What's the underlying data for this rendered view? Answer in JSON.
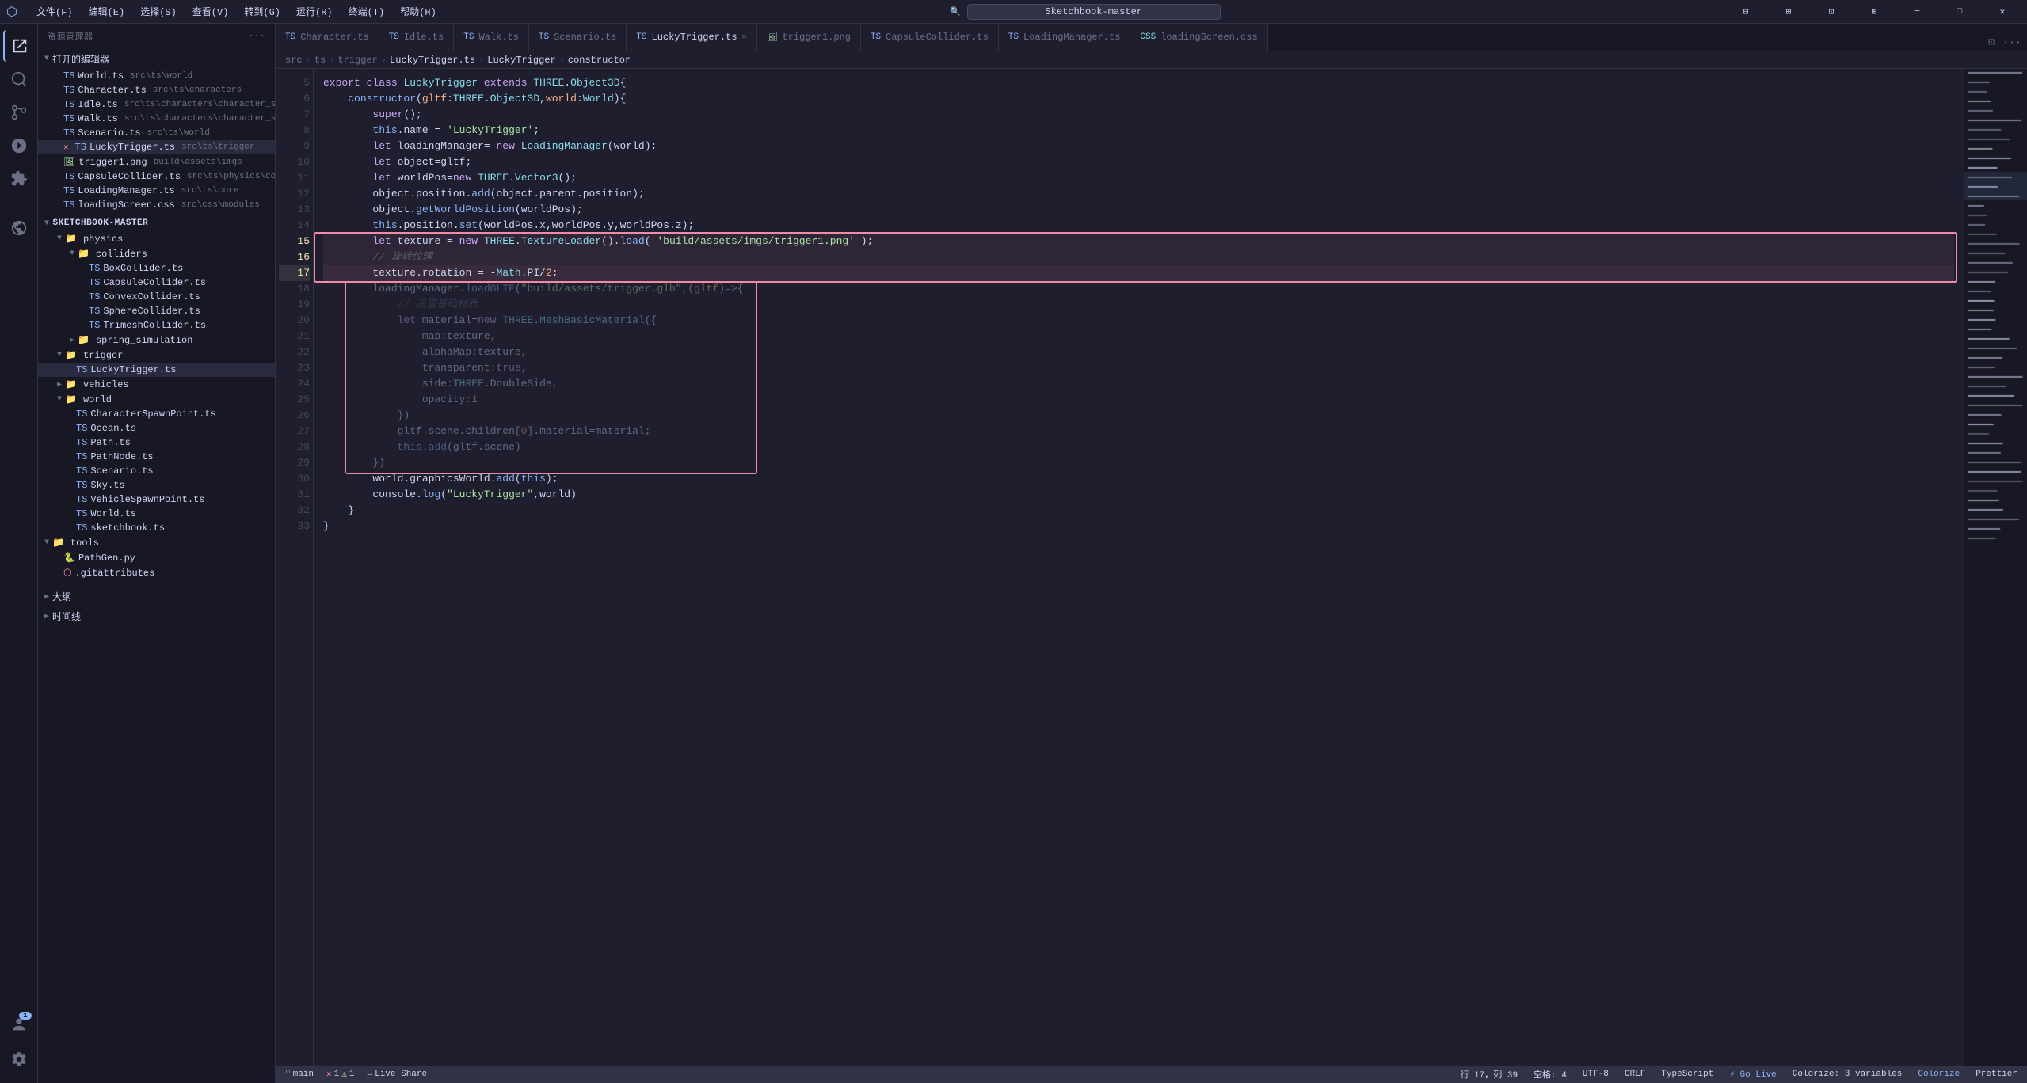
{
  "titlebar": {
    "menus": [
      "文件(F)",
      "编辑(E)",
      "选择(S)",
      "查看(V)",
      "转到(G)",
      "运行(R)",
      "终端(T)",
      "帮助(H)"
    ],
    "search_placeholder": "Sketchbook-master",
    "icon": "▶"
  },
  "activity_bar": {
    "icons": [
      {
        "name": "explorer-icon",
        "glyph": "⎘",
        "active": true
      },
      {
        "name": "search-icon",
        "glyph": "🔍"
      },
      {
        "name": "git-icon",
        "glyph": "⑂"
      },
      {
        "name": "debug-icon",
        "glyph": "▷"
      },
      {
        "name": "extensions-icon",
        "glyph": "⊞"
      },
      {
        "name": "live-share-icon",
        "glyph": "⧉"
      }
    ],
    "bottom_icons": [
      {
        "name": "account-icon",
        "glyph": "👤"
      },
      {
        "name": "settings-icon",
        "glyph": "⚙"
      }
    ]
  },
  "sidebar": {
    "title": "资源管理器",
    "section_open_editors": "打开的编辑器",
    "open_files": [
      {
        "name": "World.ts",
        "path": "src\\ts\\world",
        "icon": "ts",
        "indent": 1
      },
      {
        "name": "Character.ts",
        "path": "src\\ts\\characters",
        "icon": "ts",
        "indent": 1
      },
      {
        "name": "Idle.ts",
        "path": "src\\ts\\characters\\character_states",
        "icon": "ts",
        "indent": 1
      },
      {
        "name": "Walk.ts",
        "path": "src\\ts\\characters\\character_states",
        "icon": "ts",
        "indent": 1
      },
      {
        "name": "Scenario.ts",
        "path": "src\\ts\\world",
        "icon": "ts",
        "indent": 1
      },
      {
        "name": "LuckyTrigger.ts",
        "path": "src\\ts\\trigger",
        "icon": "ts",
        "indent": 1,
        "active": true,
        "has_close": true
      },
      {
        "name": "trigger1.png",
        "path": "build\\assets\\imgs",
        "icon": "png",
        "indent": 1
      },
      {
        "name": "CapsuleCollider.ts",
        "path": "src\\ts\\physics\\colliders",
        "icon": "ts",
        "indent": 1
      },
      {
        "name": "LoadingManager.ts",
        "path": "src\\ts\\core",
        "icon": "ts",
        "indent": 1
      },
      {
        "name": "loadingScreen.css",
        "path": "src\\css\\modules",
        "icon": "ts",
        "indent": 1
      }
    ],
    "project_name": "SKETCHBOOK-MASTER",
    "tree": [
      {
        "type": "folder",
        "name": "physics",
        "indent": 1,
        "open": true
      },
      {
        "type": "folder",
        "name": "colliders",
        "indent": 2,
        "open": true
      },
      {
        "type": "file",
        "name": "BoxCollider.ts",
        "icon": "ts",
        "indent": 3
      },
      {
        "type": "file",
        "name": "CapsuleCollider.ts",
        "icon": "ts",
        "indent": 3
      },
      {
        "type": "file",
        "name": "ConvexCollider.ts",
        "icon": "ts",
        "indent": 3
      },
      {
        "type": "file",
        "name": "SphereCollider.ts",
        "icon": "ts",
        "indent": 3
      },
      {
        "type": "file",
        "name": "TrimeshCollider.ts",
        "icon": "ts",
        "indent": 3
      },
      {
        "type": "folder",
        "name": "spring_simulation",
        "indent": 2
      },
      {
        "type": "folder",
        "name": "trigger",
        "indent": 1,
        "open": true
      },
      {
        "type": "file",
        "name": "LuckyTrigger.ts",
        "icon": "ts",
        "indent": 2,
        "active": true
      },
      {
        "type": "folder",
        "name": "vehicles",
        "indent": 1
      },
      {
        "type": "folder",
        "name": "world",
        "indent": 1,
        "open": true
      },
      {
        "type": "file",
        "name": "CharacterSpawnPoint.ts",
        "icon": "ts",
        "indent": 2
      },
      {
        "type": "file",
        "name": "Ocean.ts",
        "icon": "ts",
        "indent": 2
      },
      {
        "type": "file",
        "name": "Path.ts",
        "icon": "ts",
        "indent": 2
      },
      {
        "type": "file",
        "name": "PathNode.ts",
        "icon": "ts",
        "indent": 2
      },
      {
        "type": "file",
        "name": "Scenario.ts",
        "icon": "ts",
        "indent": 2
      },
      {
        "type": "file",
        "name": "Sky.ts",
        "icon": "ts",
        "indent": 2
      },
      {
        "type": "file",
        "name": "VehicleSpawnPoint.ts",
        "icon": "ts",
        "indent": 2
      },
      {
        "type": "file",
        "name": "World.ts",
        "icon": "ts",
        "indent": 2
      },
      {
        "type": "file",
        "name": "sketchbook.ts",
        "icon": "ts",
        "indent": 2
      },
      {
        "type": "folder",
        "name": "tools",
        "indent": 0,
        "open": true
      },
      {
        "type": "file",
        "name": "PathGen.py",
        "icon": "py",
        "indent": 1
      },
      {
        "type": "file",
        "name": ".gitattributes",
        "icon": "git",
        "indent": 1
      }
    ],
    "bottom_sections": [
      {
        "name": "大纲"
      },
      {
        "name": "时间线"
      }
    ]
  },
  "tabs": [
    {
      "label": "Character.ts",
      "icon": "ts",
      "active": false
    },
    {
      "label": "Idle.ts",
      "icon": "ts",
      "active": false
    },
    {
      "label": "Walk.ts",
      "icon": "ts",
      "active": false
    },
    {
      "label": "Scenario.ts",
      "icon": "ts",
      "active": false
    },
    {
      "label": "LuckyTrigger.ts",
      "icon": "ts",
      "active": true,
      "has_close": true
    },
    {
      "label": "trigger1.png",
      "icon": "png",
      "active": false
    },
    {
      "label": "CapsuleCollider.ts",
      "icon": "ts",
      "active": false
    },
    {
      "label": "LoadingManager.ts",
      "icon": "ts",
      "active": false
    },
    {
      "label": "loadingScreen.css",
      "icon": "css",
      "active": false
    }
  ],
  "breadcrumb": {
    "items": [
      "src",
      "ts",
      "trigger",
      "LuckyTrigger.ts",
      "LuckyTrigger",
      "constructor"
    ]
  },
  "code": {
    "lines": [
      {
        "num": 5,
        "content": "export class LuckyTrigger extends THREE.Object3D{"
      },
      {
        "num": 6,
        "content": "    constructor(gltf:THREE.Object3D,world:World){"
      },
      {
        "num": 7,
        "content": "        super();"
      },
      {
        "num": 8,
        "content": "        this.name = 'LuckyTrigger';"
      },
      {
        "num": 9,
        "content": "        let loadingManager= new LoadingManager(world);"
      },
      {
        "num": 10,
        "content": "        let object=gltf;"
      },
      {
        "num": 11,
        "content": "        let worldPos=new THREE.Vector3();"
      },
      {
        "num": 12,
        "content": "        object.position.add(object.parent.position);"
      },
      {
        "num": 13,
        "content": "        object.getWorldPosition(worldPos);"
      },
      {
        "num": 14,
        "content": "        this.position.set(worldPos.x,worldPos.y,worldPos.z);"
      },
      {
        "num": 15,
        "content": "        let texture = new THREE.TextureLoader().load( 'build/assets/imgs/trigger1.png' );",
        "highlight_red": true
      },
      {
        "num": 16,
        "content": "        // 旋转纹理",
        "highlight_red": true
      },
      {
        "num": 17,
        "content": "        texture.rotation = -Math.PI/2;",
        "highlight_red": true,
        "has_dot": true
      },
      {
        "num": 18,
        "content": "        loadingManager.loadGLTF(\"build/assets/trigger.glb\",(gltf)=>{"
      },
      {
        "num": 19,
        "content": "            // 设置基础材质"
      },
      {
        "num": 20,
        "content": "            let material=new THREE.MeshBasicMaterial({"
      },
      {
        "num": 21,
        "content": "                map:texture,"
      },
      {
        "num": 22,
        "content": "                alphaMap:texture,"
      },
      {
        "num": 23,
        "content": "                transparent:true,"
      },
      {
        "num": 24,
        "content": "                side:THREE.DoubleSide,"
      },
      {
        "num": 25,
        "content": "                opacity:1"
      },
      {
        "num": 26,
        "content": "            })"
      },
      {
        "num": 27,
        "content": "            gltf.scene.children[0].material=material;"
      },
      {
        "num": 28,
        "content": "            this.add(gltf.scene)"
      },
      {
        "num": 29,
        "content": "        })"
      },
      {
        "num": 30,
        "content": "        world.graphicsWorld.add(this);"
      },
      {
        "num": 31,
        "content": "        console.log(\"LuckyTrigger\",world)"
      },
      {
        "num": 32,
        "content": "    }"
      },
      {
        "num": 33,
        "content": "}"
      }
    ]
  },
  "status_bar": {
    "errors": "1",
    "warnings": "1",
    "position": "行 17，列 39",
    "spaces": "空格: 4",
    "encoding": "UTF-8",
    "line_endings": "CRLF",
    "language": "TypeScript",
    "go_live": "⚡ Go Live",
    "colorize_label": "Colorize: 3 variables",
    "colorize_btn": "Colorize",
    "prettier": "Prettier",
    "branch": "⑂ main"
  }
}
